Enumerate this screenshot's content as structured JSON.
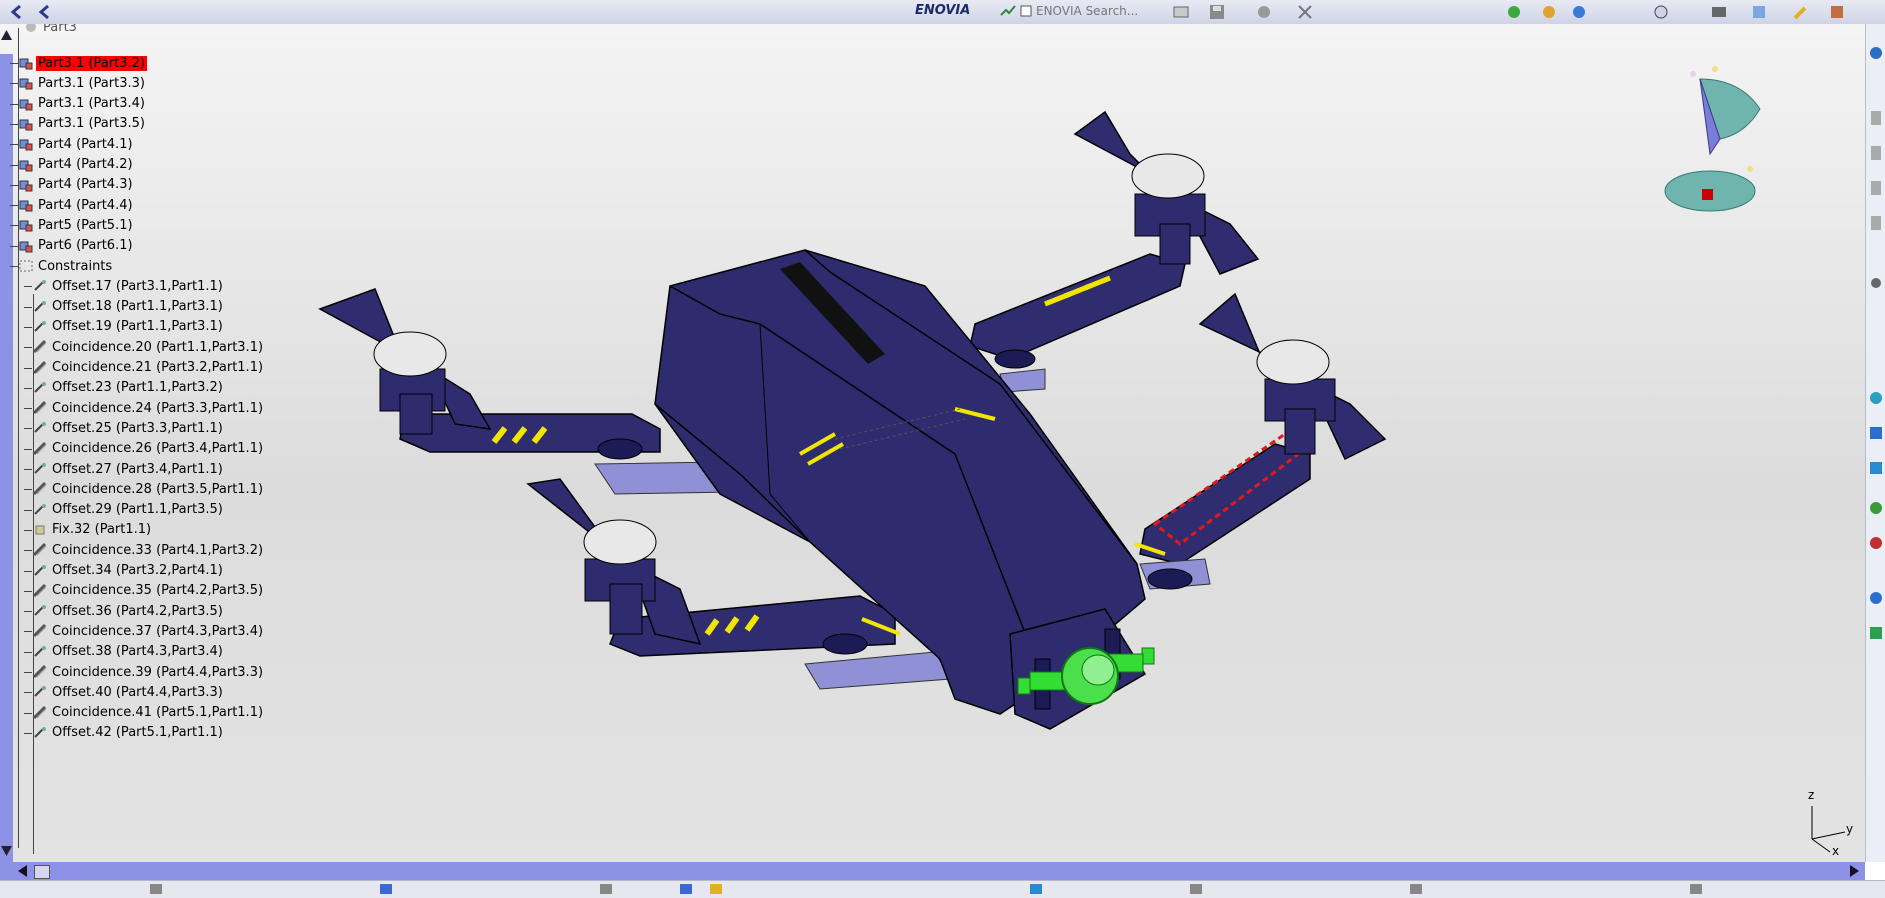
{
  "toolbar": {
    "enovia_logo": "ENOVIA",
    "search_label": "ENOVIA Search..."
  },
  "tree": {
    "header": "Part3",
    "items": [
      {
        "label": "Part3.1 (Part3.2)",
        "selected": true,
        "type": "part"
      },
      {
        "label": "Part3.1 (Part3.3)",
        "type": "part"
      },
      {
        "label": "Part3.1 (Part3.4)",
        "type": "part"
      },
      {
        "label": "Part3.1 (Part3.5)",
        "type": "part"
      },
      {
        "label": "Part4 (Part4.1)",
        "type": "part"
      },
      {
        "label": "Part4 (Part4.2)",
        "type": "part"
      },
      {
        "label": "Part4 (Part4.3)",
        "type": "part"
      },
      {
        "label": "Part4 (Part4.4)",
        "type": "part"
      },
      {
        "label": "Part5 (Part5.1)",
        "type": "part"
      },
      {
        "label": "Part6 (Part6.1)",
        "type": "part"
      },
      {
        "label": "Constraints",
        "type": "folder"
      }
    ],
    "constraints": [
      {
        "label": "Offset.17 (Part3.1,Part1.1)",
        "type": "offset"
      },
      {
        "label": "Offset.18 (Part1.1,Part3.1)",
        "type": "offset"
      },
      {
        "label": "Offset.19 (Part1.1,Part3.1)",
        "type": "offset"
      },
      {
        "label": "Coincidence.20 (Part1.1,Part3.1)",
        "type": "coincidence"
      },
      {
        "label": "Coincidence.21 (Part3.2,Part1.1)",
        "type": "coincidence"
      },
      {
        "label": "Offset.23 (Part1.1,Part3.2)",
        "type": "offset"
      },
      {
        "label": "Coincidence.24 (Part3.3,Part1.1)",
        "type": "coincidence"
      },
      {
        "label": "Offset.25 (Part3.3,Part1.1)",
        "type": "offset"
      },
      {
        "label": "Coincidence.26 (Part3.4,Part1.1)",
        "type": "coincidence"
      },
      {
        "label": "Offset.27 (Part3.4,Part1.1)",
        "type": "offset"
      },
      {
        "label": "Coincidence.28 (Part3.5,Part1.1)",
        "type": "coincidence"
      },
      {
        "label": "Offset.29 (Part1.1,Part3.5)",
        "type": "offset"
      },
      {
        "label": "Fix.32 (Part1.1)",
        "type": "fix"
      },
      {
        "label": "Coincidence.33 (Part4.1,Part3.2)",
        "type": "coincidence"
      },
      {
        "label": "Offset.34 (Part3.2,Part4.1)",
        "type": "offset"
      },
      {
        "label": "Coincidence.35 (Part4.2,Part3.5)",
        "type": "coincidence"
      },
      {
        "label": "Offset.36 (Part4.2,Part3.5)",
        "type": "offset"
      },
      {
        "label": "Coincidence.37 (Part4.3,Part3.4)",
        "type": "coincidence"
      },
      {
        "label": "Offset.38 (Part4.3,Part3.4)",
        "type": "offset"
      },
      {
        "label": "Coincidence.39 (Part4.4,Part3.3)",
        "type": "coincidence"
      },
      {
        "label": "Offset.40 (Part4.4,Part3.3)",
        "type": "offset"
      },
      {
        "label": "Coincidence.41 (Part5.1,Part1.1)",
        "type": "coincidence"
      },
      {
        "label": "Offset.42 (Part5.1,Part1.1)",
        "type": "offset"
      }
    ]
  },
  "compass": {
    "z": "z",
    "x": "x",
    "y": "y"
  },
  "axis": {
    "z": "z",
    "y": "y",
    "x": "x"
  },
  "colors": {
    "selection": "#ff0000",
    "body": "#2e2c6e",
    "scrollbar": "#8e92e6",
    "hubs": "#e8e8e8",
    "stripes": "#f2e600",
    "lens": "#33dd33"
  }
}
